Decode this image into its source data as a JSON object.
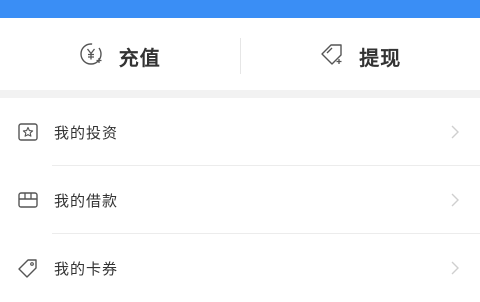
{
  "header": {
    "accent_color": "#3a8ef5"
  },
  "actions": [
    {
      "label": "充值",
      "icon": "yen-coin-icon"
    },
    {
      "label": "提现",
      "icon": "withdraw-tag-icon"
    }
  ],
  "menu": [
    {
      "label": "我的投资",
      "icon": "investment-star-icon"
    },
    {
      "label": "我的借款",
      "icon": "loan-wallet-icon"
    },
    {
      "label": "我的卡券",
      "icon": "coupon-tag-icon"
    }
  ]
}
